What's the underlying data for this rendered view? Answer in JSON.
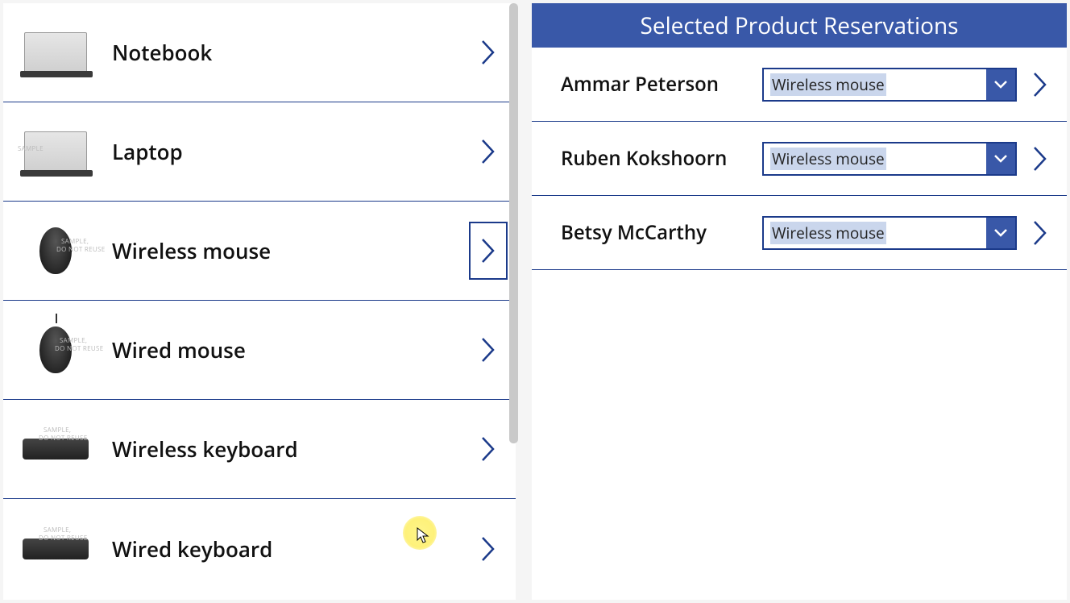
{
  "products": [
    {
      "label": "Notebook",
      "selected": false,
      "thumb": "laptop"
    },
    {
      "label": "Laptop",
      "selected": false,
      "thumb": "laptop"
    },
    {
      "label": "Wireless mouse",
      "selected": true,
      "thumb": "mouse"
    },
    {
      "label": "Wired mouse",
      "selected": false,
      "thumb": "wmouse"
    },
    {
      "label": "Wireless keyboard",
      "selected": false,
      "thumb": "keyboard"
    },
    {
      "label": "Wired keyboard",
      "selected": false,
      "thumb": "keyboard"
    }
  ],
  "right": {
    "header": "Selected Product Reservations",
    "reservations": [
      {
        "name": "Ammar Peterson",
        "value": "Wireless mouse"
      },
      {
        "name": "Ruben Kokshoorn",
        "value": "Wireless mouse"
      },
      {
        "name": "Betsy McCarthy",
        "value": "Wireless mouse"
      }
    ]
  }
}
